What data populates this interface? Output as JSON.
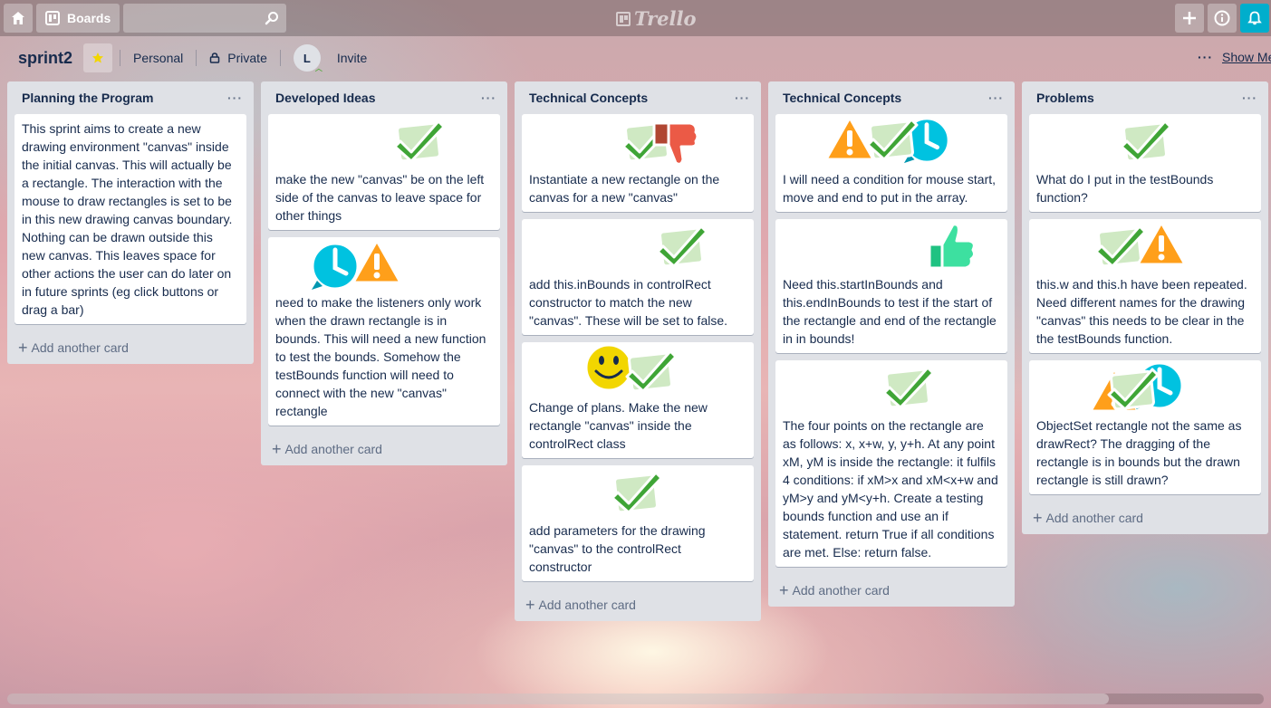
{
  "header": {
    "boards_label": "Boards",
    "search_placeholder": "",
    "logo_text": "Trello"
  },
  "board": {
    "title": "sprint2",
    "team_label": "Personal",
    "visibility_label": "Private",
    "member_initial": "L",
    "invite_label": "Invite",
    "menu_dots": "···",
    "show_menu_label": "Show Menu"
  },
  "add_card_label": "Add another card",
  "list_menu_dots": "···",
  "lists": [
    {
      "title": "Planning the Program",
      "cards": [
        {
          "text": "This sprint aims to create a new drawing environment \"canvas\" inside the initial canvas. This will actually be a rectangle. The interaction with the mouse to draw rectangles is set to be in this new drawing canvas boundary. Nothing can be drawn outside this new canvas. This leaves space for other actions the user can do later on in future sprints (eg click buttons or drag a bar)",
          "stickers": []
        }
      ]
    },
    {
      "title": "Developed Ideas",
      "cards": [
        {
          "text": "make the new \"canvas\" be on the left side of the canvas to leave space for other things",
          "stickers": [
            "check-sticker"
          ]
        },
        {
          "text": "need to make the listeners only work when the drawn rectangle is in bounds. This will need a new function to test the bounds. Somehow the testBounds function will need to connect with the new \"canvas\" rectangle",
          "stickers": [
            "clock-sticker",
            "warning-sticker"
          ]
        }
      ]
    },
    {
      "title": "Technical Concepts",
      "cards": [
        {
          "text": "Instantiate a new rectangle on the canvas for a new \"canvas\"",
          "stickers": [
            "check-sticker",
            "thumbs-down-sticker"
          ]
        },
        {
          "text": "add this.inBounds in controlRect constructor to match the new \"canvas\". These will be set to false.",
          "stickers": [
            "check-sticker"
          ]
        },
        {
          "text": "Change of plans. Make the new rectangle \"canvas\" inside the controlRect class",
          "stickers": [
            "smile-sticker",
            "check-sticker"
          ]
        },
        {
          "text": "add parameters for the drawing \"canvas\" to the controlRect constructor",
          "stickers": [
            "check-sticker"
          ]
        }
      ]
    },
    {
      "title": "Technical Concepts",
      "cards": [
        {
          "text": "I will need a condition for mouse start, move and end to put in the array.",
          "stickers": [
            "warning-sticker",
            "check-sticker",
            "clock-sticker"
          ]
        },
        {
          "text": "Need this.startInBounds and this.endInBounds to test if the start of the rectangle and end of the rectangle in in bounds!",
          "stickers": [
            "thumbs-up-sticker"
          ]
        },
        {
          "text": "The four points on the rectangle are as follows: x, x+w, y, y+h. At any point xM, yM is inside the rectangle: it fulfils 4 conditions: if xM>x and xM<x+w and yM>y and yM<y+h. Create a testing bounds function and use an if statement. return True if all conditions are met. Else: return false.",
          "stickers": [
            "check-sticker"
          ]
        }
      ]
    },
    {
      "title": "Problems",
      "cards": [
        {
          "text": "What do I put in the testBounds function?",
          "stickers": [
            "check-sticker"
          ]
        },
        {
          "text": "this.w and this.h have been repeated. Need different names for the drawing \"canvas\" this needs to be clear in the the testBounds function.",
          "stickers": [
            "check-sticker",
            "warning-sticker"
          ]
        },
        {
          "text": "ObjectSet rectangle not the same as drawRect? The dragging of the rectangle is in bounds but the drawn rectangle is still drawn?",
          "stickers": [
            "warning-sticker",
            "clock-sticker",
            "check-sticker"
          ]
        }
      ]
    }
  ],
  "colors": {
    "list_bg": "#dfe1e6",
    "card_bg": "#ffffff",
    "check_green": "#5aac44",
    "warning_orange": "#ff9f1a",
    "clock_blue": "#00c2e0",
    "thumbs_down_red": "#eb5a46",
    "thumbs_up_green": "#3de0a0",
    "smile_yellow": "#f2d600",
    "bell_blue": "#00aecc"
  }
}
